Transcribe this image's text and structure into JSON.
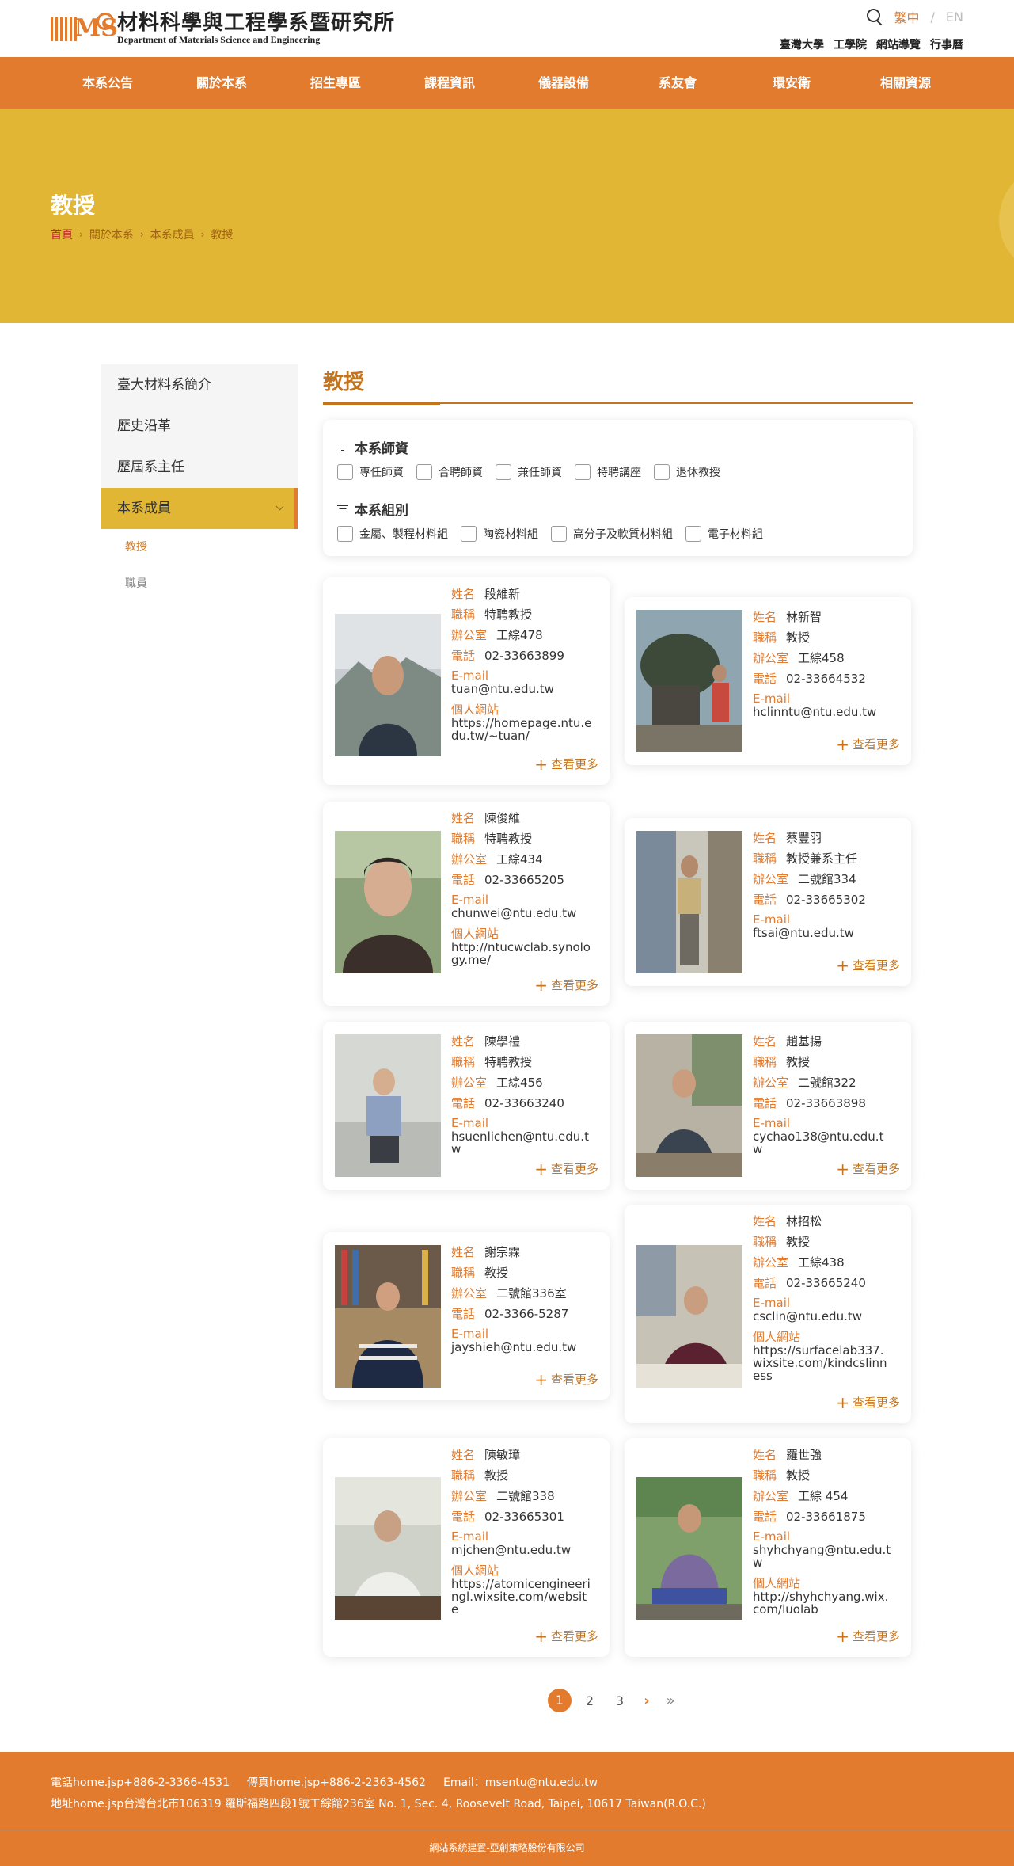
{
  "header": {
    "logo_zh": "材料科學與工程學系暨研究所",
    "logo_en": "Department of Materials Science and Engineering",
    "logo_mark": "MS",
    "lang_active": "繁中",
    "lang_sep": "/",
    "lang_en": "EN",
    "top_links": [
      "臺灣大學",
      "工學院",
      "網站導覽",
      "行事曆"
    ]
  },
  "nav": [
    "本系公告",
    "關於本系",
    "招生專區",
    "課程資訊",
    "儀器設備",
    "系友會",
    "環安衛",
    "相關資源"
  ],
  "hero": {
    "title": "教授",
    "breadcrumb": [
      "首頁",
      "關於本系",
      "本系成員",
      "教授"
    ],
    "crumb_sep": "›"
  },
  "sidebar": {
    "items": [
      "臺大材料系簡介",
      "歷史沿革",
      "歷屆系主任",
      "本系成員"
    ],
    "subitems": [
      "教授",
      "職員"
    ]
  },
  "main": {
    "title": "教授"
  },
  "filters": {
    "group1_title": "本系師資",
    "group1": [
      "專任師資",
      "合聘師資",
      "兼任師資",
      "特聘講座",
      "退休教授"
    ],
    "group2_title": "本系組別",
    "group2": [
      "金屬、製程材料組",
      "陶瓷材料組",
      "高分子及軟質材料組",
      "電子材料組"
    ]
  },
  "labels": {
    "name": "姓名",
    "title": "職稱",
    "office": "辦公室",
    "phone": "電話",
    "email": "E-mail",
    "website": "個人網站",
    "more": "查看更多",
    "plus": "+"
  },
  "faculty": [
    {
      "name": "段維新",
      "title": "特聘教授",
      "office": "工綜478",
      "phone": "02-33663899",
      "email": "tuan@ntu.edu.tw",
      "website_l1": "https://homepage.ntu.e",
      "website_l2": "du.tw/~tuan/"
    },
    {
      "name": "林新智",
      "title": "教授",
      "office": "工綜458",
      "phone": "02-33664532",
      "email": "hclinntu@ntu.edu.tw"
    },
    {
      "name": "陳俊維",
      "title": "特聘教授",
      "office": "工綜434",
      "phone": "02-33665205",
      "email": "chunwei@ntu.edu.tw",
      "website_l1": "http://ntucwclab.synolo",
      "website_l2": "gy.me/"
    },
    {
      "name": "蔡豐羽",
      "title": "教授兼系主任",
      "office": "二號館334",
      "phone": "02-33665302",
      "email": "ftsai@ntu.edu.tw"
    },
    {
      "name": "陳學禮",
      "title": "特聘教授",
      "office": "工綜456",
      "phone": "02-33663240",
      "email_l1": "hsuenlichen@ntu.edu.t",
      "email_l2": "w"
    },
    {
      "name": "趙基揚",
      "title": "教授",
      "office": "二號館322",
      "phone": "02-33663898",
      "email_l1": "cychao138@ntu.edu.t",
      "email_l2": "w"
    },
    {
      "name": "謝宗霖",
      "title": "教授",
      "office": "二號館336室",
      "phone": "02-3366-5287",
      "email": "jayshieh@ntu.edu.tw"
    },
    {
      "name": "林招松",
      "title": "教授",
      "office": "工綜438",
      "phone": "02-33665240",
      "email": "csclin@ntu.edu.tw",
      "website_l1": "https://surfacelab337.",
      "website_l2": "wixsite.com/kindcslinn",
      "website_l3": "ess"
    },
    {
      "name": "陳敏璋",
      "title": "教授",
      "office": "二號館338",
      "phone": "02-33665301",
      "email": "mjchen@ntu.edu.tw",
      "website_l1": "https://atomicengineeri",
      "website_l2": "ngl.wixsite.com/websit",
      "website_l3": "e"
    },
    {
      "name": "羅世強",
      "title": "教授",
      "office": "工綜 454",
      "phone": "02-33661875",
      "email_l1": "shyhchyang@ntu.edu.t",
      "email_l2": "w",
      "website_l1": "http://shyhchyang.wix.",
      "website_l2": "com/luolab"
    }
  ],
  "pager": {
    "pages": [
      "1",
      "2",
      "3"
    ],
    "next": "›",
    "last": "»"
  },
  "footer": {
    "phone": "電話home.jsp+886-2-3366-4531",
    "fax": "傳真home.jsp+886-2-2363-4562",
    "email": "Email：msentu@ntu.edu.tw",
    "address": "地址home.jsp台灣台北市106319 羅斯福路四段1號工綜館236室 No. 1, Sec. 4, Roosevelt Road, Taipei, 10617 Taiwan(R.O.C.)",
    "copyright": "網站系統建置-亞創策略股份有限公司"
  },
  "colors": {
    "accent": "#e27b2e",
    "hero": "#e1b634",
    "title": "#c5741e"
  }
}
